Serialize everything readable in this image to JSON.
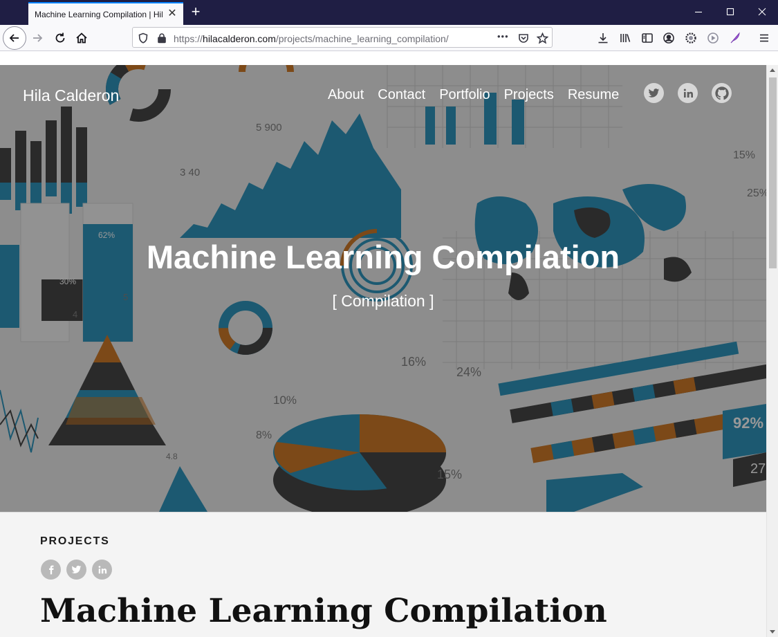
{
  "browser": {
    "tab_title": "Machine Learning Compilation | Hila Calderon",
    "url_prefix": "https://",
    "url_host": "hilacalderon.com",
    "url_path": "/projects/machine_learning_compilation/",
    "more_label": "•••"
  },
  "site": {
    "brand": "Hila Calderon",
    "menu": [
      "About",
      "Contact",
      "Portfolio",
      "Projects",
      "Resume"
    ],
    "social_icons": [
      "twitter-icon",
      "linkedin-icon",
      "github-icon"
    ]
  },
  "hero": {
    "title": "Machine Learning Compilation",
    "subtitle": "[ Compilation ]"
  },
  "hero_art_text": {
    "figures": [
      "5 900",
      "3 40",
      "62%",
      "30%",
      "16%",
      "24%",
      "10%",
      "8%",
      "15%",
      "92%",
      "15%",
      "25%",
      "4",
      "5",
      "4.8",
      "27"
    ]
  },
  "content": {
    "section_label": "PROJECTS",
    "share_icons": [
      "facebook-icon",
      "twitter-icon",
      "linkedin-icon"
    ],
    "page_title": "Machine Learning Compilation"
  },
  "colors": {
    "titlebar": "#1f1e44",
    "accent_blue": "#1287b4",
    "accent_orange": "#c9690a",
    "dark_gray": "#2d2d2d"
  }
}
